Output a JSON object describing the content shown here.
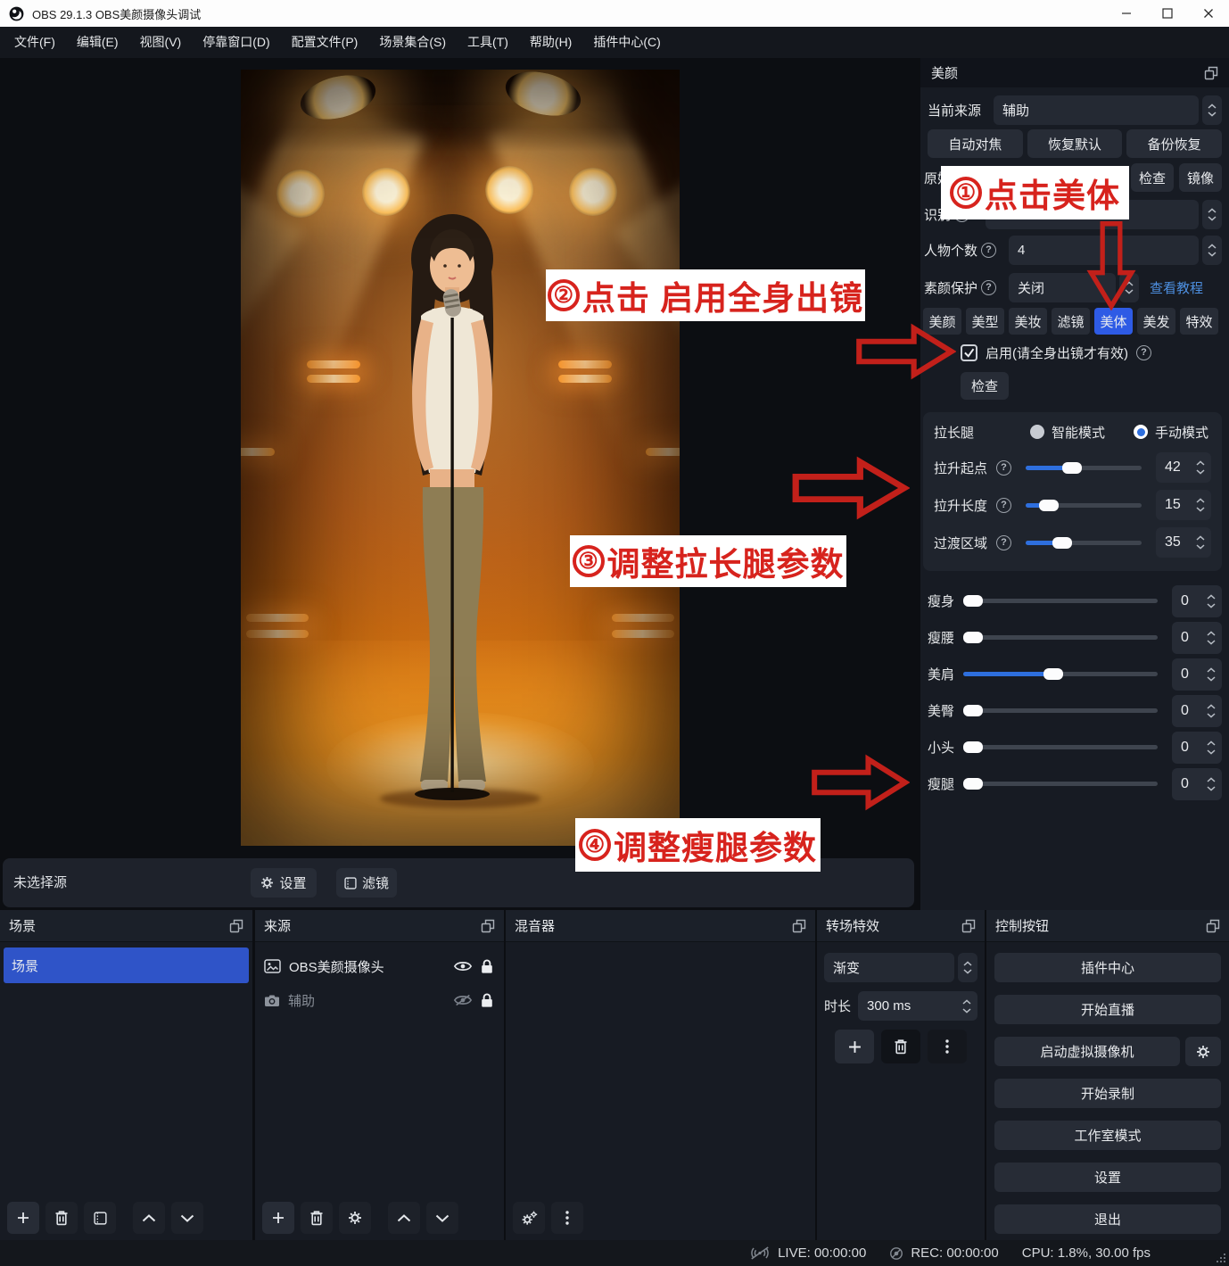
{
  "window": {
    "title": "OBS 29.1.3  OBS美颜摄像头调试"
  },
  "menu": {
    "items": [
      "文件(F)",
      "编辑(E)",
      "视图(V)",
      "停靠窗口(D)",
      "配置文件(P)",
      "场景集合(S)",
      "工具(T)",
      "帮助(H)",
      "插件中心(C)"
    ]
  },
  "beauty": {
    "title": "美颜",
    "current_source": {
      "label": "当前来源",
      "value": "辅助"
    },
    "action_buttons": {
      "autofocus": "自动对焦",
      "restore": "恢复默认",
      "backup": "备份恢复"
    },
    "original_row": {
      "label": "原始",
      "check": "检查",
      "mirror": "镜像"
    },
    "recognize_row": {
      "label": "识别"
    },
    "person_count": {
      "label": "人物个数",
      "value": "4"
    },
    "makeup_protect": {
      "label": "素颜保护",
      "value": "关闭",
      "tutorial_link": "查看教程"
    },
    "tabs": [
      "美颜",
      "美型",
      "美妆",
      "滤镜",
      "美体",
      "美发",
      "特效"
    ],
    "active_tab": "美体",
    "enable_row": {
      "label": "启用(请全身出镜才有效)",
      "checked": true
    },
    "check_button": "检查",
    "leg": {
      "title": "拉长腿",
      "smart_mode": "智能模式",
      "manual_mode": "手动模式",
      "selected_mode": "手动模式",
      "sliders": [
        {
          "label": "拉升起点",
          "value": "42",
          "percent": 38
        },
        {
          "label": "拉升长度",
          "value": "15",
          "percent": 14
        },
        {
          "label": "过渡区域",
          "value": "35",
          "percent": 28
        }
      ]
    },
    "body_sliders": [
      {
        "label": "瘦身",
        "value": "0",
        "percent": 0
      },
      {
        "label": "瘦腰",
        "value": "0",
        "percent": 0
      },
      {
        "label": "美肩",
        "value": "0",
        "percent": 46
      },
      {
        "label": "美臀",
        "value": "0",
        "percent": 0
      },
      {
        "label": "小头",
        "value": "0",
        "percent": 0
      },
      {
        "label": "瘦腿",
        "value": "0",
        "percent": 0
      }
    ]
  },
  "preview_toolbar": {
    "no_source": "未选择源",
    "settings": "设置",
    "filters": "滤镜"
  },
  "scenes": {
    "title": "场景",
    "items": [
      {
        "label": "场景",
        "selected": true
      }
    ]
  },
  "sources": {
    "title": "来源",
    "items": [
      {
        "label": "OBS美颜摄像头",
        "visible": true,
        "locked": true
      },
      {
        "label": "辅助",
        "visible": false,
        "locked": true
      }
    ]
  },
  "mixer": {
    "title": "混音器"
  },
  "transitions": {
    "title": "转场特效",
    "type": "渐变",
    "duration_label": "时长",
    "duration": "300 ms"
  },
  "controls": {
    "title": "控制按钮",
    "buttons": [
      "插件中心",
      "开始直播",
      "启动虚拟摄像机",
      "开始录制",
      "工作室模式",
      "设置",
      "退出"
    ]
  },
  "statusbar": {
    "live": "LIVE: 00:00:00",
    "rec": "REC: 00:00:00",
    "cpu": "CPU: 1.8%, 30.00 fps"
  },
  "annotations": {
    "step1": {
      "num": "①",
      "text": "点击美体"
    },
    "step2": {
      "num": "②",
      "text": "点击 启用全身出镜"
    },
    "step3": {
      "num": "③",
      "text": "调整拉长腿参数"
    },
    "step4": {
      "num": "④",
      "text": "调整瘦腿参数"
    }
  },
  "colors": {
    "annotation_red": "#d7231d",
    "selection_blue": "#2f54c8",
    "tab_active_blue": "#2e5be5",
    "slider_blue": "#2e6fde",
    "link_blue": "#4d8fe0"
  }
}
